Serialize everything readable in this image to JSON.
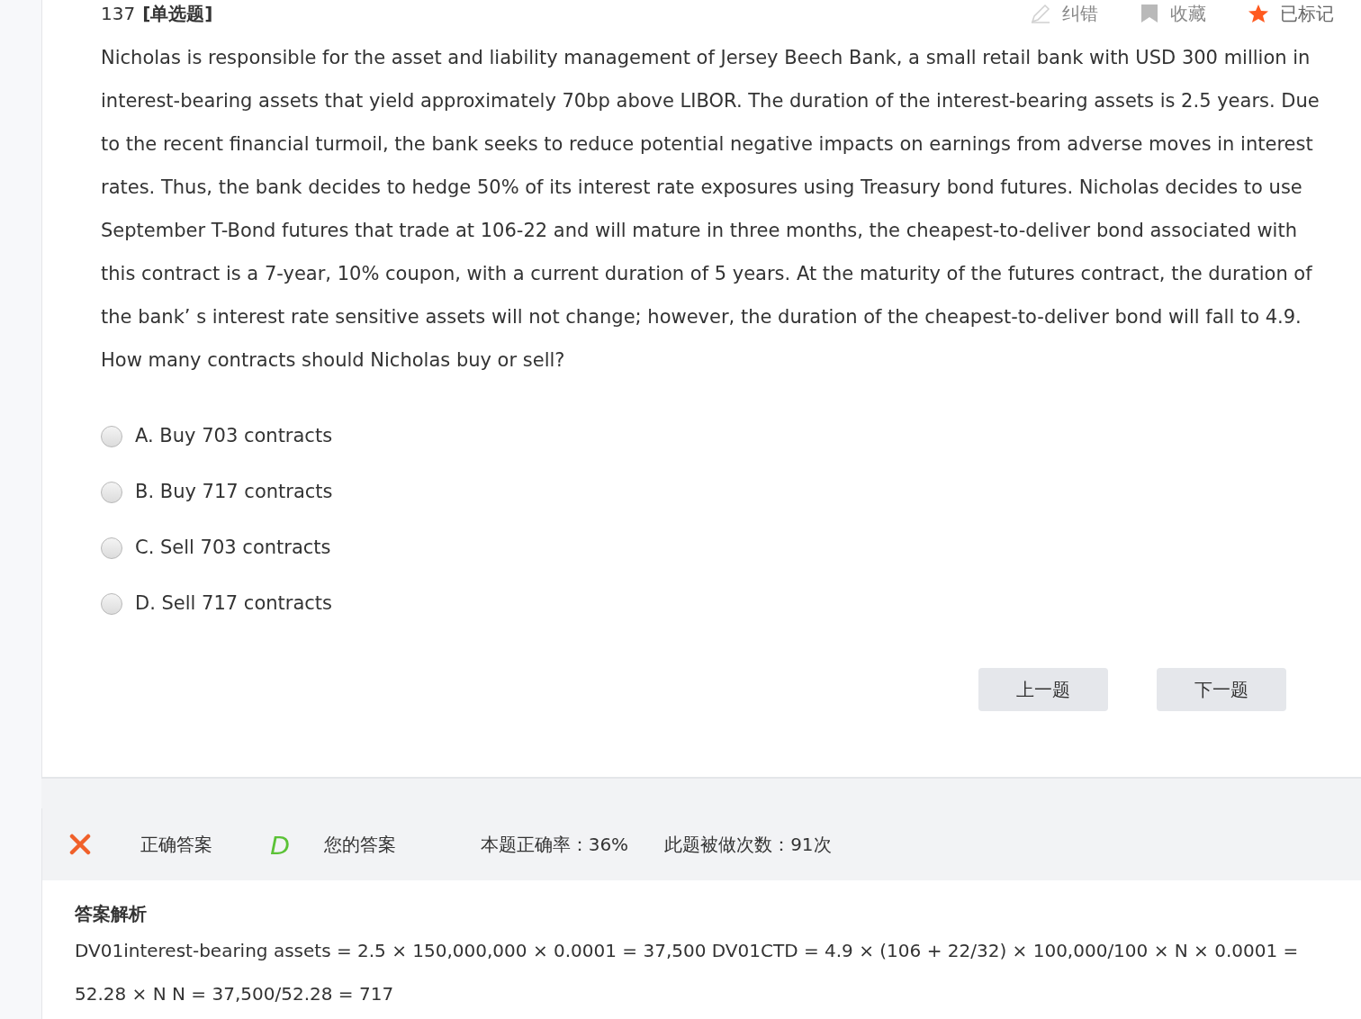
{
  "question": {
    "number": "137",
    "type_label": "[单选题]",
    "actions": [
      {
        "kind": "edit",
        "label": "纠错",
        "active": false
      },
      {
        "kind": "bookmark",
        "label": "收藏",
        "active": false
      },
      {
        "kind": "star",
        "label": "已标记",
        "active": true
      }
    ],
    "text": "Nicholas is responsible for the asset and liability management of Jersey Beech Bank, a small retail bank with USD 300 million in interest-bearing assets that yield approximately 70bp above LIBOR. The duration of the interest-bearing assets is 2.5 years. Due to the recent financial turmoil, the bank seeks to reduce potential negative impacts on earnings from adverse moves in interest rates. Thus, the bank decides to hedge 50% of its interest rate exposures using Treasury bond futures. Nicholas decides to use September T-Bond futures that trade at 106-22 and will mature in three months, the cheapest-to-deliver bond associated with this contract is a 7-year, 10% coupon, with a current duration of 5 years. At the maturity of the futures contract, the duration of the bank’ s interest rate sensitive assets will not change; however, the duration of the cheapest-to-deliver bond will fall to 4.9. How many contracts should Nicholas buy or sell?",
    "options": [
      {
        "label": "A. Buy 703 contracts",
        "selected": false
      },
      {
        "label": "B. Buy 717 contracts",
        "selected": false
      },
      {
        "label": "C. Sell 703 contracts",
        "selected": false
      },
      {
        "label": "D. Sell 717 contracts",
        "selected": false
      }
    ],
    "buttons": [
      "上一题",
      "下一题"
    ]
  },
  "result": {
    "correct": false,
    "correct_label": "正确答案",
    "correct_answer": "D",
    "your_label": "您的答案",
    "accuracy": "本题正确率：36%",
    "attempts": "此题被做次数：91次"
  },
  "explanation": {
    "title": "答案解析",
    "text": "DV01interest-bearing assets = 2.5 × 150,000,000 × 0.0001 = 37,500 DV01CTD = 4.9 × (106 + 22/32) × 100,000/100 × N × 0.0001 = 52.28 × N N = 37,500/52.28 = 717"
  }
}
